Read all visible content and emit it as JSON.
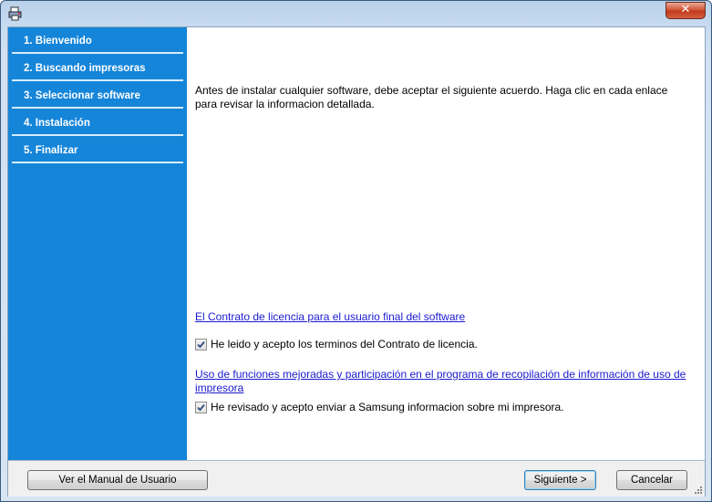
{
  "window": {
    "title": "",
    "close_label": "✕"
  },
  "sidebar": {
    "steps": [
      {
        "label": "1. Bienvenido"
      },
      {
        "label": "2. Buscando impresoras"
      },
      {
        "label": "3. Seleccionar software"
      },
      {
        "label": "4. Instalación"
      },
      {
        "label": "5. Finalizar"
      }
    ]
  },
  "main": {
    "intro_text": "Antes de instalar cualquier software, debe aceptar el siguiente acuerdo. Haga clic en cada enlace para revisar la informacion detallada.",
    "license_link": "El Contrato de licencia para el usuario final del software",
    "license_checkbox": {
      "label": "He leido y acepto los terminos del Contrato de licencia.",
      "checked": true
    },
    "data_link": "Uso de funciones mejoradas y participación en el programa de recopilación de información de uso de impresora",
    "data_checkbox": {
      "label": "He revisado y acepto enviar a Samsung informacion sobre mi impresora.",
      "checked": true
    }
  },
  "footer": {
    "manual_button": "Ver el Manual de Usuario",
    "next_button": "Siguiente >",
    "cancel_button": "Cancelar"
  },
  "colors": {
    "sidebar": "#1585d9",
    "link": "#1a1ad0"
  }
}
